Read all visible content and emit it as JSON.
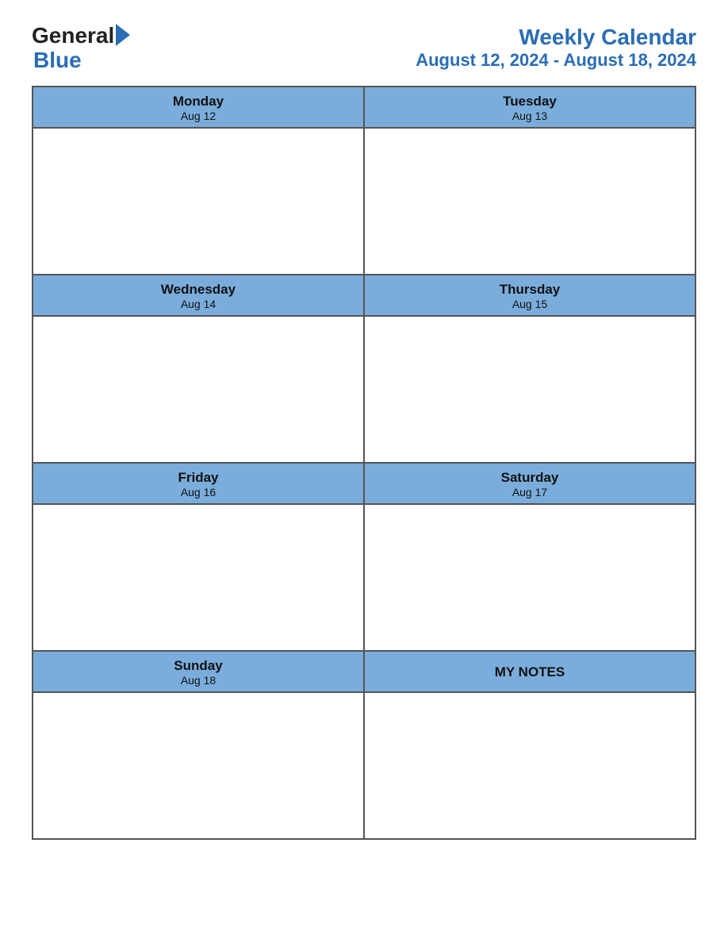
{
  "header": {
    "logo": {
      "general": "General",
      "blue": "Blue",
      "arrow_color": "#2a6db5"
    },
    "title": "Weekly Calendar",
    "dates": "August 12, 2024 - August 18, 2024"
  },
  "calendar": {
    "rows": [
      {
        "cells": [
          {
            "day": "Monday",
            "date": "Aug 12",
            "type": "day"
          },
          {
            "day": "Tuesday",
            "date": "Aug 13",
            "type": "day"
          }
        ]
      },
      {
        "cells": [
          {
            "day": "Wednesday",
            "date": "Aug 14",
            "type": "day"
          },
          {
            "day": "Thursday",
            "date": "Aug 15",
            "type": "day"
          }
        ]
      },
      {
        "cells": [
          {
            "day": "Friday",
            "date": "Aug 16",
            "type": "day"
          },
          {
            "day": "Saturday",
            "date": "Aug 17",
            "type": "day"
          }
        ]
      },
      {
        "cells": [
          {
            "day": "Sunday",
            "date": "Aug 18",
            "type": "day"
          },
          {
            "day": "MY NOTES",
            "date": "",
            "type": "notes"
          }
        ]
      }
    ]
  }
}
